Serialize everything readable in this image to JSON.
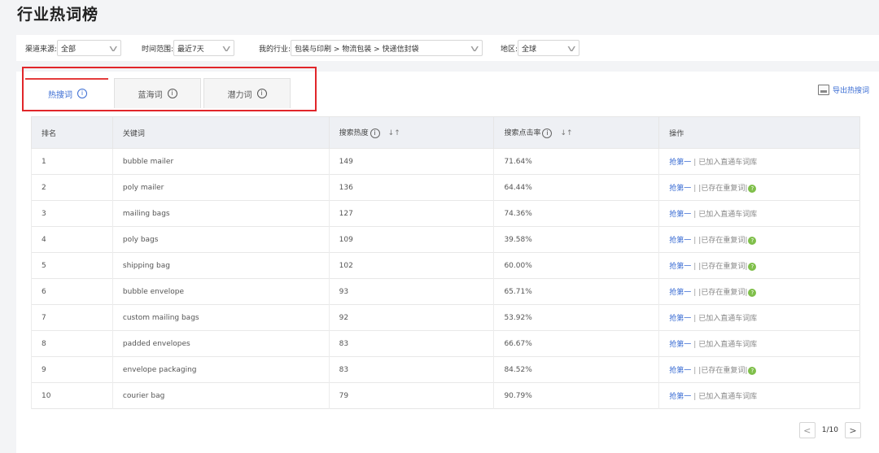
{
  "page": {
    "title": "行业热词榜"
  },
  "filters": {
    "channel": {
      "label": "渠道来源:",
      "value": "全部"
    },
    "time": {
      "label": "时间范围:",
      "value": "最近7天"
    },
    "industry": {
      "label": "我的行业:",
      "value": "包装与印刷 > 物流包装 > 快递信封袋"
    },
    "region": {
      "label": "地区:",
      "value": "全球"
    }
  },
  "tabs": [
    {
      "label": "热搜词",
      "active": true
    },
    {
      "label": "蓝海词",
      "active": false
    },
    {
      "label": "潜力词",
      "active": false
    }
  ],
  "export": {
    "label": "导出热搜词"
  },
  "table": {
    "headers": {
      "rank": "排名",
      "keyword": "关键词",
      "heat": "搜索热度",
      "ctr": "搜索点击率",
      "ops": "操作"
    },
    "rows": [
      {
        "rank": "1",
        "keyword": "bubble mailer",
        "heat": "149",
        "ctr": "71.64%",
        "op_link": "抢第一",
        "op_text": "已加入直通车词库",
        "help": false
      },
      {
        "rank": "2",
        "keyword": "poly mailer",
        "heat": "136",
        "ctr": "64.44%",
        "op_link": "抢第一",
        "op_text": "|已存在重复词|",
        "help": true
      },
      {
        "rank": "3",
        "keyword": "mailing bags",
        "heat": "127",
        "ctr": "74.36%",
        "op_link": "抢第一",
        "op_text": "已加入直通车词库",
        "help": false
      },
      {
        "rank": "4",
        "keyword": "poly bags",
        "heat": "109",
        "ctr": "39.58%",
        "op_link": "抢第一",
        "op_text": "|已存在重复词|",
        "help": true
      },
      {
        "rank": "5",
        "keyword": "shipping bag",
        "heat": "102",
        "ctr": "60.00%",
        "op_link": "抢第一",
        "op_text": "|已存在重复词|",
        "help": true
      },
      {
        "rank": "6",
        "keyword": "bubble envelope",
        "heat": "93",
        "ctr": "65.71%",
        "op_link": "抢第一",
        "op_text": "|已存在重复词|",
        "help": true
      },
      {
        "rank": "7",
        "keyword": "custom mailing bags",
        "heat": "92",
        "ctr": "53.92%",
        "op_link": "抢第一",
        "op_text": "已加入直通车词库",
        "help": false
      },
      {
        "rank": "8",
        "keyword": "padded envelopes",
        "heat": "83",
        "ctr": "66.67%",
        "op_link": "抢第一",
        "op_text": "已加入直通车词库",
        "help": false
      },
      {
        "rank": "9",
        "keyword": "envelope packaging",
        "heat": "83",
        "ctr": "84.52%",
        "op_link": "抢第一",
        "op_text": "|已存在重复词|",
        "help": true
      },
      {
        "rank": "10",
        "keyword": "courier bag",
        "heat": "79",
        "ctr": "90.79%",
        "op_link": "抢第一",
        "op_text": "已加入直通车词库",
        "help": false
      }
    ]
  },
  "pagination": {
    "text": "1/10"
  },
  "colors": {
    "accent": "#3a6cd3",
    "highlight_box": "#e1262a",
    "help_icon": "#7fbf4a"
  }
}
